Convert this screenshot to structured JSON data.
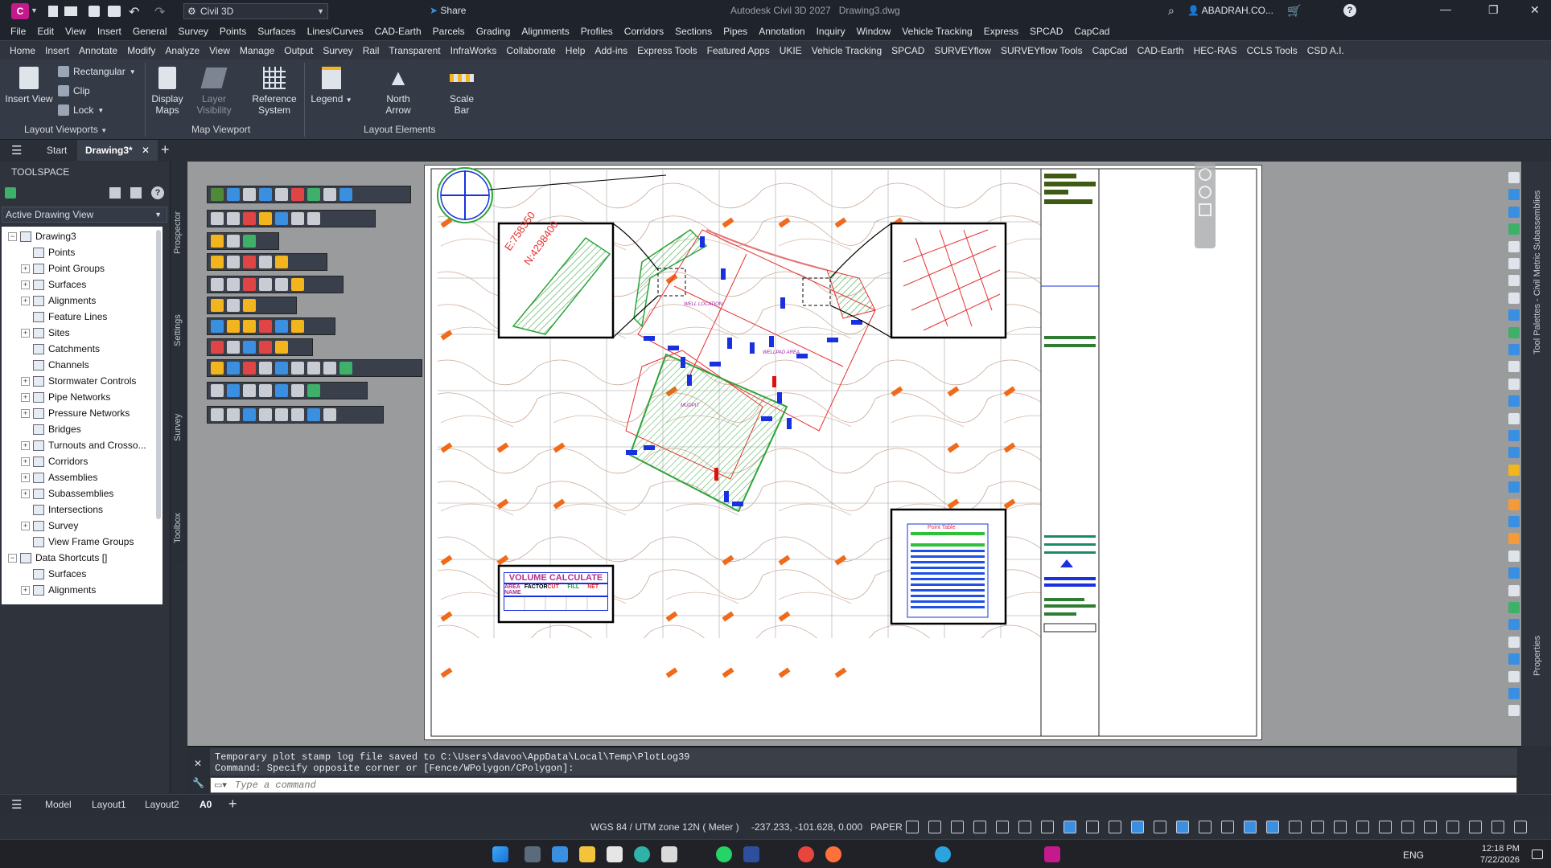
{
  "app": {
    "title": "Autodesk Civil 3D 2027",
    "document": "Drawing3.dwg",
    "workspace": "Civil 3D",
    "share_label": "Share",
    "user": "ABADRAH.CO...",
    "brand_color": "#c51a8b",
    "accent_color": "#3b8fe0"
  },
  "menu": [
    "File",
    "Edit",
    "View",
    "Insert",
    "General",
    "Survey",
    "Points",
    "Surfaces",
    "Lines/Curves",
    "CAD-Earth",
    "Parcels",
    "Grading",
    "Alignments",
    "Profiles",
    "Corridors",
    "Sections",
    "Pipes",
    "Annotation",
    "Inquiry",
    "Window",
    "Vehicle Tracking",
    "Express",
    "SPCAD",
    "CapCad"
  ],
  "ribbon_tabs": [
    "Home",
    "Insert",
    "Annotate",
    "Modify",
    "Analyze",
    "View",
    "Manage",
    "Output",
    "Survey",
    "Rail",
    "Transparent",
    "InfraWorks",
    "Collaborate",
    "Help",
    "Add-ins",
    "Express Tools",
    "Featured Apps",
    "UKIE",
    "Vehicle Tracking",
    "SPCAD",
    "SURVEYflow",
    "SURVEYflow Tools",
    "CapCad",
    "CAD-Earth",
    "HEC-RAS",
    "CCLS Tools",
    "CSD A.I."
  ],
  "ribbon": {
    "insert_view": "Insert View",
    "rectangular": "Rectangular",
    "clip": "Clip",
    "lock": "Lock",
    "display_maps": "Display Maps",
    "layer_visibility": "Layer Visibility",
    "reference_system": "Reference System",
    "legend": "Legend",
    "north_arrow": "North Arrow",
    "scale_bar": "Scale Bar",
    "panel_layout_viewports": "Layout Viewports",
    "panel_map_viewport": "Map Viewport",
    "panel_layout_elements": "Layout Elements"
  },
  "doc_tabs": {
    "start": "Start",
    "drawing": "Drawing3*"
  },
  "toolspace": {
    "title": "TOOLSPACE",
    "view_select": "Active Drawing View",
    "tree": [
      {
        "label": "Drawing3",
        "level": 0,
        "exp": "−"
      },
      {
        "label": "Points",
        "level": 1,
        "exp": ""
      },
      {
        "label": "Point Groups",
        "level": 1,
        "exp": "+"
      },
      {
        "label": "Surfaces",
        "level": 1,
        "exp": "+"
      },
      {
        "label": "Alignments",
        "level": 1,
        "exp": "+"
      },
      {
        "label": "Feature Lines",
        "level": 1,
        "exp": ""
      },
      {
        "label": "Sites",
        "level": 1,
        "exp": "+"
      },
      {
        "label": "Catchments",
        "level": 1,
        "exp": ""
      },
      {
        "label": "Channels",
        "level": 1,
        "exp": ""
      },
      {
        "label": "Stormwater Controls",
        "level": 1,
        "exp": "+"
      },
      {
        "label": "Pipe Networks",
        "level": 1,
        "exp": "+"
      },
      {
        "label": "Pressure Networks",
        "level": 1,
        "exp": "+"
      },
      {
        "label": "Bridges",
        "level": 1,
        "exp": ""
      },
      {
        "label": "Turnouts and Crosso...",
        "level": 1,
        "exp": "+"
      },
      {
        "label": "Corridors",
        "level": 1,
        "exp": "+"
      },
      {
        "label": "Assemblies",
        "level": 1,
        "exp": "+"
      },
      {
        "label": "Subassemblies",
        "level": 1,
        "exp": "+"
      },
      {
        "label": "Intersections",
        "level": 1,
        "exp": ""
      },
      {
        "label": "Survey",
        "level": 1,
        "exp": "+"
      },
      {
        "label": "View Frame Groups",
        "level": 1,
        "exp": ""
      },
      {
        "label": "Data Shortcuts []",
        "level": 0,
        "exp": "−"
      },
      {
        "label": "Surfaces",
        "level": 1,
        "exp": ""
      },
      {
        "label": "Alignments",
        "level": 1,
        "exp": "+"
      }
    ],
    "side_tabs": [
      "Prospector",
      "Settings",
      "Survey",
      "Toolbox"
    ]
  },
  "drawing": {
    "coord_e": "E:758350",
    "coord_n": "N:4298400",
    "label_well": "WELL LOCATION",
    "label_wellpad": "WELLPAD AREA",
    "label_mudpit": "MUDPIT",
    "volume_title": "VOLUME CALCULATE",
    "volume_headers": [
      "AREA NAME",
      "FACTOR",
      "CUT",
      "FILL",
      "NET"
    ],
    "point_table_title": "Point Table"
  },
  "command": {
    "line1": "Temporary plot stamp log file saved to C:\\Users\\davoo\\AppData\\Local\\Temp\\PlotLog39",
    "line2": "Command: Specify opposite corner or [Fence/WPolygon/CPolygon]:",
    "placeholder": "Type a command"
  },
  "layout_tabs": [
    "Model",
    "Layout1",
    "Layout2",
    "A0"
  ],
  "status": {
    "coord_system": "WGS 84 / UTM zone 12N ( Meter )",
    "coords": "-237.233, -101.628, 0.000",
    "space": "PAPER"
  },
  "right_palettes": [
    "Tool Palettes - Civil Metric Subassemblies",
    "Properties"
  ],
  "taskbar": {
    "lang": "ENG",
    "time": "12:18 PM",
    "date": "7/22/2026"
  }
}
